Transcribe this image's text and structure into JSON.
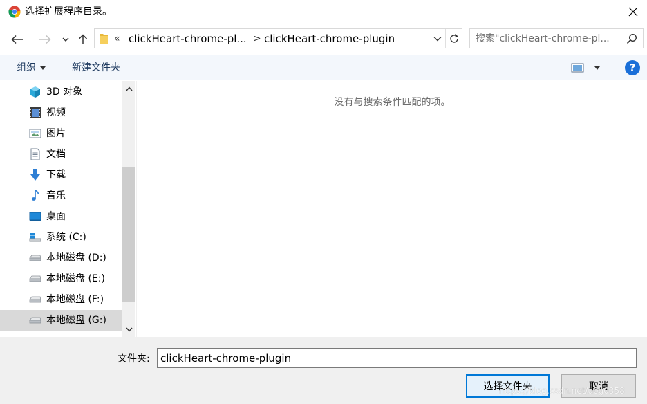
{
  "window": {
    "title": "选择扩展程序目录。",
    "app_icon": "chrome-icon",
    "close_icon": "close-icon"
  },
  "address": {
    "overflow": "«",
    "crumbs": [
      "clickHeart-chrome-pl...",
      "clickHeart-chrome-plugin"
    ],
    "separator": ">",
    "search_placeholder": "搜索\"clickHeart-chrome-pl..."
  },
  "toolbar": {
    "organize": "组织",
    "new_folder": "新建文件夹",
    "help": "?"
  },
  "sidebar": {
    "items": [
      {
        "label": "3D 对象",
        "icon": "3d-objects-icon"
      },
      {
        "label": "视频",
        "icon": "video-icon"
      },
      {
        "label": "图片",
        "icon": "picture-icon"
      },
      {
        "label": "文档",
        "icon": "document-icon"
      },
      {
        "label": "下载",
        "icon": "download-icon"
      },
      {
        "label": "音乐",
        "icon": "music-icon"
      },
      {
        "label": "桌面",
        "icon": "desktop-icon"
      },
      {
        "label": "系统 (C:)",
        "icon": "system-drive-icon"
      },
      {
        "label": "本地磁盘 (D:)",
        "icon": "drive-icon"
      },
      {
        "label": "本地磁盘 (E:)",
        "icon": "drive-icon"
      },
      {
        "label": "本地磁盘 (F:)",
        "icon": "drive-icon"
      },
      {
        "label": "本地磁盘 (G:)",
        "icon": "drive-icon",
        "selected": true
      }
    ]
  },
  "content": {
    "empty_message": "没有与搜索条件匹配的项。"
  },
  "footer": {
    "folder_label": "文件夹:",
    "folder_value": "clickHeart-chrome-plugin",
    "select_button": "选择文件夹",
    "cancel_button": "取消",
    "watermark": "https://blog.csdn.net/u0g0358"
  },
  "colors": {
    "accent": "#0078d7",
    "toolbar_bg": "#f3f7fc",
    "selected_bg": "#d9d9d9"
  }
}
